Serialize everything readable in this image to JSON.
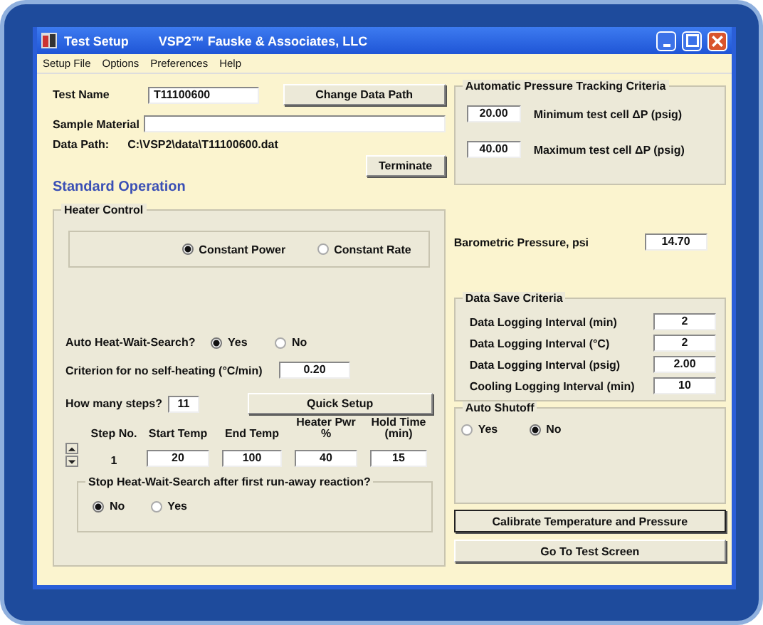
{
  "window": {
    "title": "Test Setup",
    "subtitle": "VSP2™ Fauske & Associates, LLC"
  },
  "menu": [
    "Setup File",
    "Options",
    "Preferences",
    "Help"
  ],
  "test_name": {
    "label": "Test Name",
    "value": "T11100600"
  },
  "change_path_button": "Change Data Path",
  "sample_material": {
    "label": "Sample Material"
  },
  "data_path": {
    "label": "Data Path:",
    "value": "C:\\VSP2\\data\\T11100600.dat"
  },
  "terminate_button": "Terminate",
  "section_title": "Standard Operation",
  "heater_control": {
    "title": "Heater Control",
    "mode_options": [
      {
        "label": "Constant Power",
        "selected": true
      },
      {
        "label": "Constant Rate",
        "selected": false
      }
    ],
    "auto_search": {
      "label": "Auto Heat-Wait-Search?",
      "options": [
        {
          "label": "Yes",
          "selected": true
        },
        {
          "label": "No",
          "selected": false
        }
      ]
    },
    "criterion": {
      "label": "Criterion for no self-heating (°C/min)",
      "value": "0.20"
    },
    "steps": {
      "label": "How many steps?",
      "value": "11"
    },
    "quick_setup_button": "Quick Setup",
    "step_table": {
      "columns": [
        "Step No.",
        "Start Temp",
        "End Temp",
        "Heater Pwr %",
        "Hold Time (min)"
      ],
      "row": {
        "step": "1",
        "start_temp": "20",
        "end_temp": "100",
        "heater_pwr": "40",
        "hold_time": "15"
      }
    },
    "runaway": {
      "title": "Stop Heat-Wait-Search after first run-away reaction?",
      "options": [
        {
          "label": "No",
          "selected": true
        },
        {
          "label": "Yes",
          "selected": false
        }
      ]
    }
  },
  "pressure_tracking": {
    "title": "Automatic Pressure Tracking Criteria",
    "fields": [
      {
        "value": "20.00",
        "label": "Minimum test cell ΔP (psig)"
      },
      {
        "value": "40.00",
        "label": "Maximum test cell ΔP (psig)"
      }
    ]
  },
  "barometric": {
    "label": "Barometric Pressure, psi",
    "value": "14.70"
  },
  "data_save": {
    "title": "Data Save Criteria",
    "fields": [
      {
        "label": "Data Logging Interval (min)",
        "value": "2"
      },
      {
        "label": "Data Logging Interval (°C)",
        "value": "2"
      },
      {
        "label": "Data Logging Interval (psig)",
        "value": "2.00"
      },
      {
        "label": "Cooling Logging Interval (min)",
        "value": "10"
      }
    ]
  },
  "auto_shutoff": {
    "title": "Auto Shutoff",
    "options": [
      {
        "label": "Yes",
        "selected": false
      },
      {
        "label": "No",
        "selected": true
      }
    ]
  },
  "buttons": [
    {
      "label": "Calibrate Temperature and Pressure",
      "default": true
    },
    {
      "label": "Go To Test Screen",
      "default": false
    }
  ]
}
